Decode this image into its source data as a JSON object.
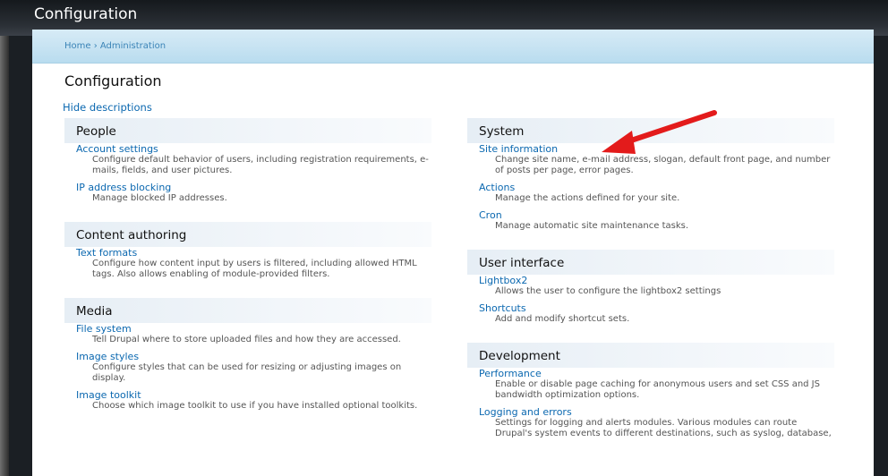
{
  "window": {
    "title": "Configuration"
  },
  "breadcrumb": "Home › Administration",
  "page_title": "Configuration",
  "hide_descriptions": "Hide descriptions",
  "colors": {
    "link": "#0b68b0",
    "annotation_arrow": "#e31b1b"
  },
  "left_column": [
    {
      "heading": "People",
      "items": [
        {
          "label": "Account settings",
          "description": "Configure default behavior of users, including registration requirements, e-mails, fields, and user pictures."
        },
        {
          "label": "IP address blocking",
          "description": "Manage blocked IP addresses."
        }
      ]
    },
    {
      "heading": "Content authoring",
      "items": [
        {
          "label": "Text formats",
          "description": "Configure how content input by users is filtered, including allowed HTML tags. Also allows enabling of module-provided filters."
        }
      ]
    },
    {
      "heading": "Media",
      "items": [
        {
          "label": "File system",
          "description": "Tell Drupal where to store uploaded files and how they are accessed."
        },
        {
          "label": "Image styles",
          "description": "Configure styles that can be used for resizing or adjusting images on display."
        },
        {
          "label": "Image toolkit",
          "description": "Choose which image toolkit to use if you have installed optional toolkits."
        }
      ]
    }
  ],
  "right_column": [
    {
      "heading": "System",
      "items": [
        {
          "label": "Site information",
          "description": "Change site name, e-mail address, slogan, default front page, and number of posts per page, error pages."
        },
        {
          "label": "Actions",
          "description": "Manage the actions defined for your site."
        },
        {
          "label": "Cron",
          "description": "Manage automatic site maintenance tasks."
        }
      ]
    },
    {
      "heading": "User interface",
      "items": [
        {
          "label": "Lightbox2",
          "description": "Allows the user to configure the lightbox2 settings"
        },
        {
          "label": "Shortcuts",
          "description": "Add and modify shortcut sets."
        }
      ]
    },
    {
      "heading": "Development",
      "items": [
        {
          "label": "Performance",
          "description": "Enable or disable page caching for anonymous users and set CSS and JS bandwidth optimization options."
        },
        {
          "label": "Logging and errors",
          "description": "Settings for logging and alerts modules. Various modules can route Drupal's system events to different destinations, such as syslog, database,"
        }
      ]
    }
  ]
}
